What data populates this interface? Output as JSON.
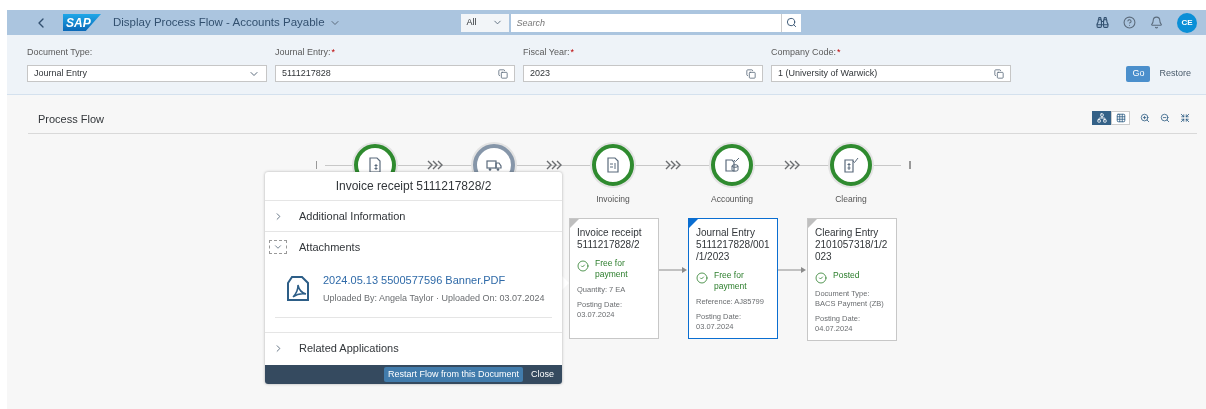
{
  "shell": {
    "logo": "SAP",
    "title": "Display Process Flow - Accounts Payable",
    "search_scope": "All",
    "search_placeholder": "Search",
    "avatar": "CE"
  },
  "filters": [
    {
      "label": "Document Type:",
      "value": "Journal Entry",
      "kind": "select"
    },
    {
      "label": "Journal Entry:",
      "required_mark": "*",
      "value": "5111217828",
      "kind": "value_help"
    },
    {
      "label": "Fiscal Year:",
      "required_mark": "*",
      "value": "2023",
      "kind": "value_help"
    },
    {
      "label": "Company Code:",
      "required_mark": "*",
      "value": "1 (University of Warwick)",
      "kind": "value_help"
    }
  ],
  "filter_actions": [
    {
      "label": "Go",
      "kind": "emphasized"
    },
    {
      "label": "Restore",
      "kind": "plain"
    }
  ],
  "process_flow": {
    "title": "Process Flow",
    "views": [
      {
        "kind": "graph",
        "selected": true
      },
      {
        "kind": "table",
        "selected": false
      }
    ],
    "lanes": [
      {
        "completed": true
      },
      {
        "completed": false
      },
      {
        "completed": true,
        "label": "Invoicing",
        "card": {
          "title_lines": [
            "Invoice receipt",
            "5111217828/2"
          ],
          "selected": false,
          "status": "Free for payment",
          "details": [
            [
              "Quantity: 7 EA"
            ],
            [
              "Posting Date:",
              "03.07.2024"
            ]
          ]
        }
      },
      {
        "completed": true,
        "label": "Accounting",
        "card": {
          "title_lines": [
            "Journal Entry",
            "5111217828/001",
            "/1/2023"
          ],
          "selected": true,
          "status": "Free for payment",
          "details": [
            [
              "Reference: AJ85799"
            ],
            [
              "Posting Date:",
              "03.07.2024"
            ]
          ]
        }
      },
      {
        "completed": true,
        "label": "Clearing",
        "card": {
          "title_lines": [
            "Clearing Entry",
            "2101057318/1/2",
            "023"
          ],
          "selected": false,
          "status": "Posted",
          "details": [
            [
              "Document Type:",
              "BACS Payment (ZB)"
            ],
            [
              "Posting Date:",
              "04.07.2024"
            ]
          ]
        }
      }
    ]
  },
  "popover": {
    "title": "Invoice receipt 5111217828/2",
    "sections": [
      {
        "title": "Additional Information",
        "expanded": false
      },
      {
        "title": "Attachments",
        "expanded": true,
        "attachments": [
          {
            "name": "2024.05.13 5500577596 Banner.PDF",
            "meta": "Uploaded By: Angela Taylor · Uploaded On: 03.07.2024"
          }
        ]
      },
      {
        "title": "Related Applications",
        "expanded": false
      }
    ],
    "actions": [
      {
        "label": "Restart Flow from this Document",
        "kind": "emphasized"
      },
      {
        "label": "Close",
        "kind": "plain"
      }
    ]
  }
}
